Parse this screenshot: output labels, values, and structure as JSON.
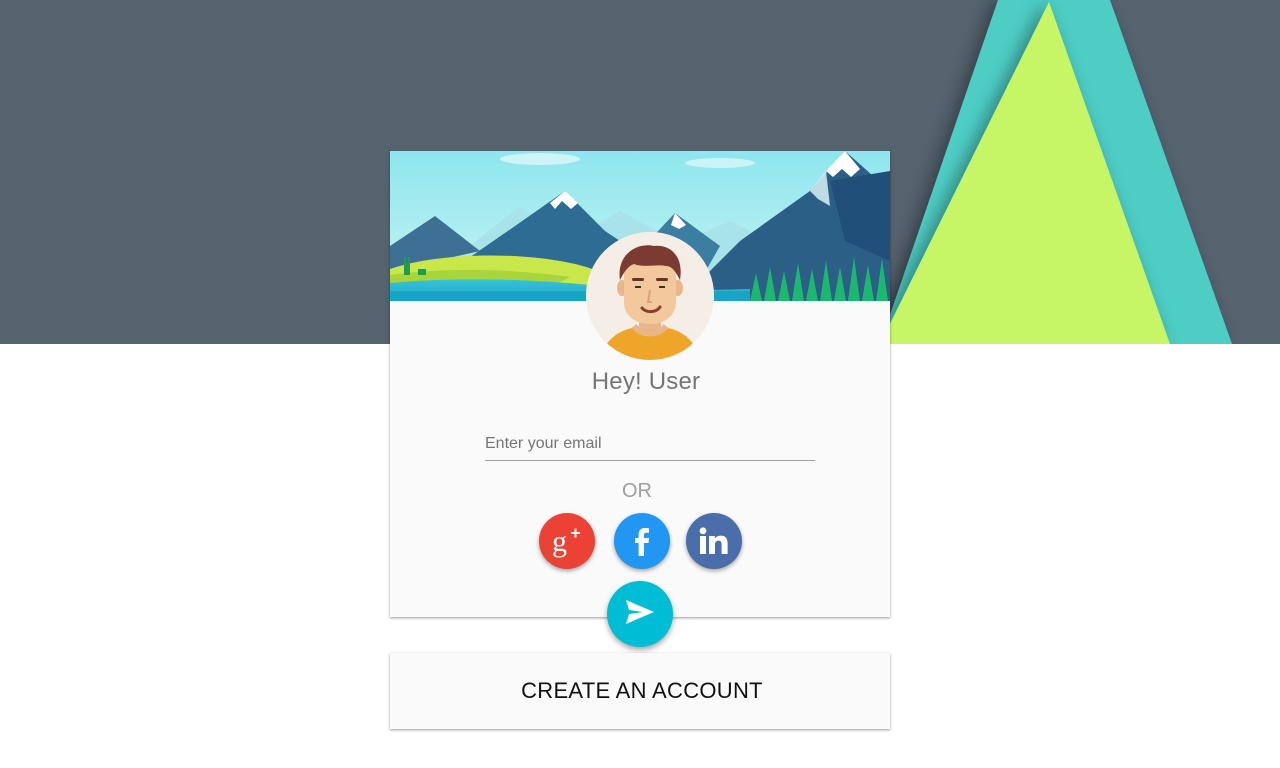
{
  "greeting": "Hey! User",
  "email": {
    "value": "",
    "placeholder": "Enter your email"
  },
  "divider_text": "OR",
  "social_buttons": [
    {
      "name": "google-plus",
      "icon": "google-plus-icon",
      "color": "#ea4335"
    },
    {
      "name": "facebook",
      "icon": "facebook-icon",
      "color": "#2196f3"
    },
    {
      "name": "linkedin",
      "icon": "linkedin-icon",
      "color": "#4a6ea9"
    }
  ],
  "submit": {
    "icon": "send-icon",
    "color": "#00bcd4"
  },
  "create_account_label": "CREATE AN ACCOUNT",
  "colors": {
    "header_band": "#55636f",
    "triangle_teal": "#4ecdc4",
    "triangle_lime": "#c6f566",
    "card": "#fafafa"
  }
}
